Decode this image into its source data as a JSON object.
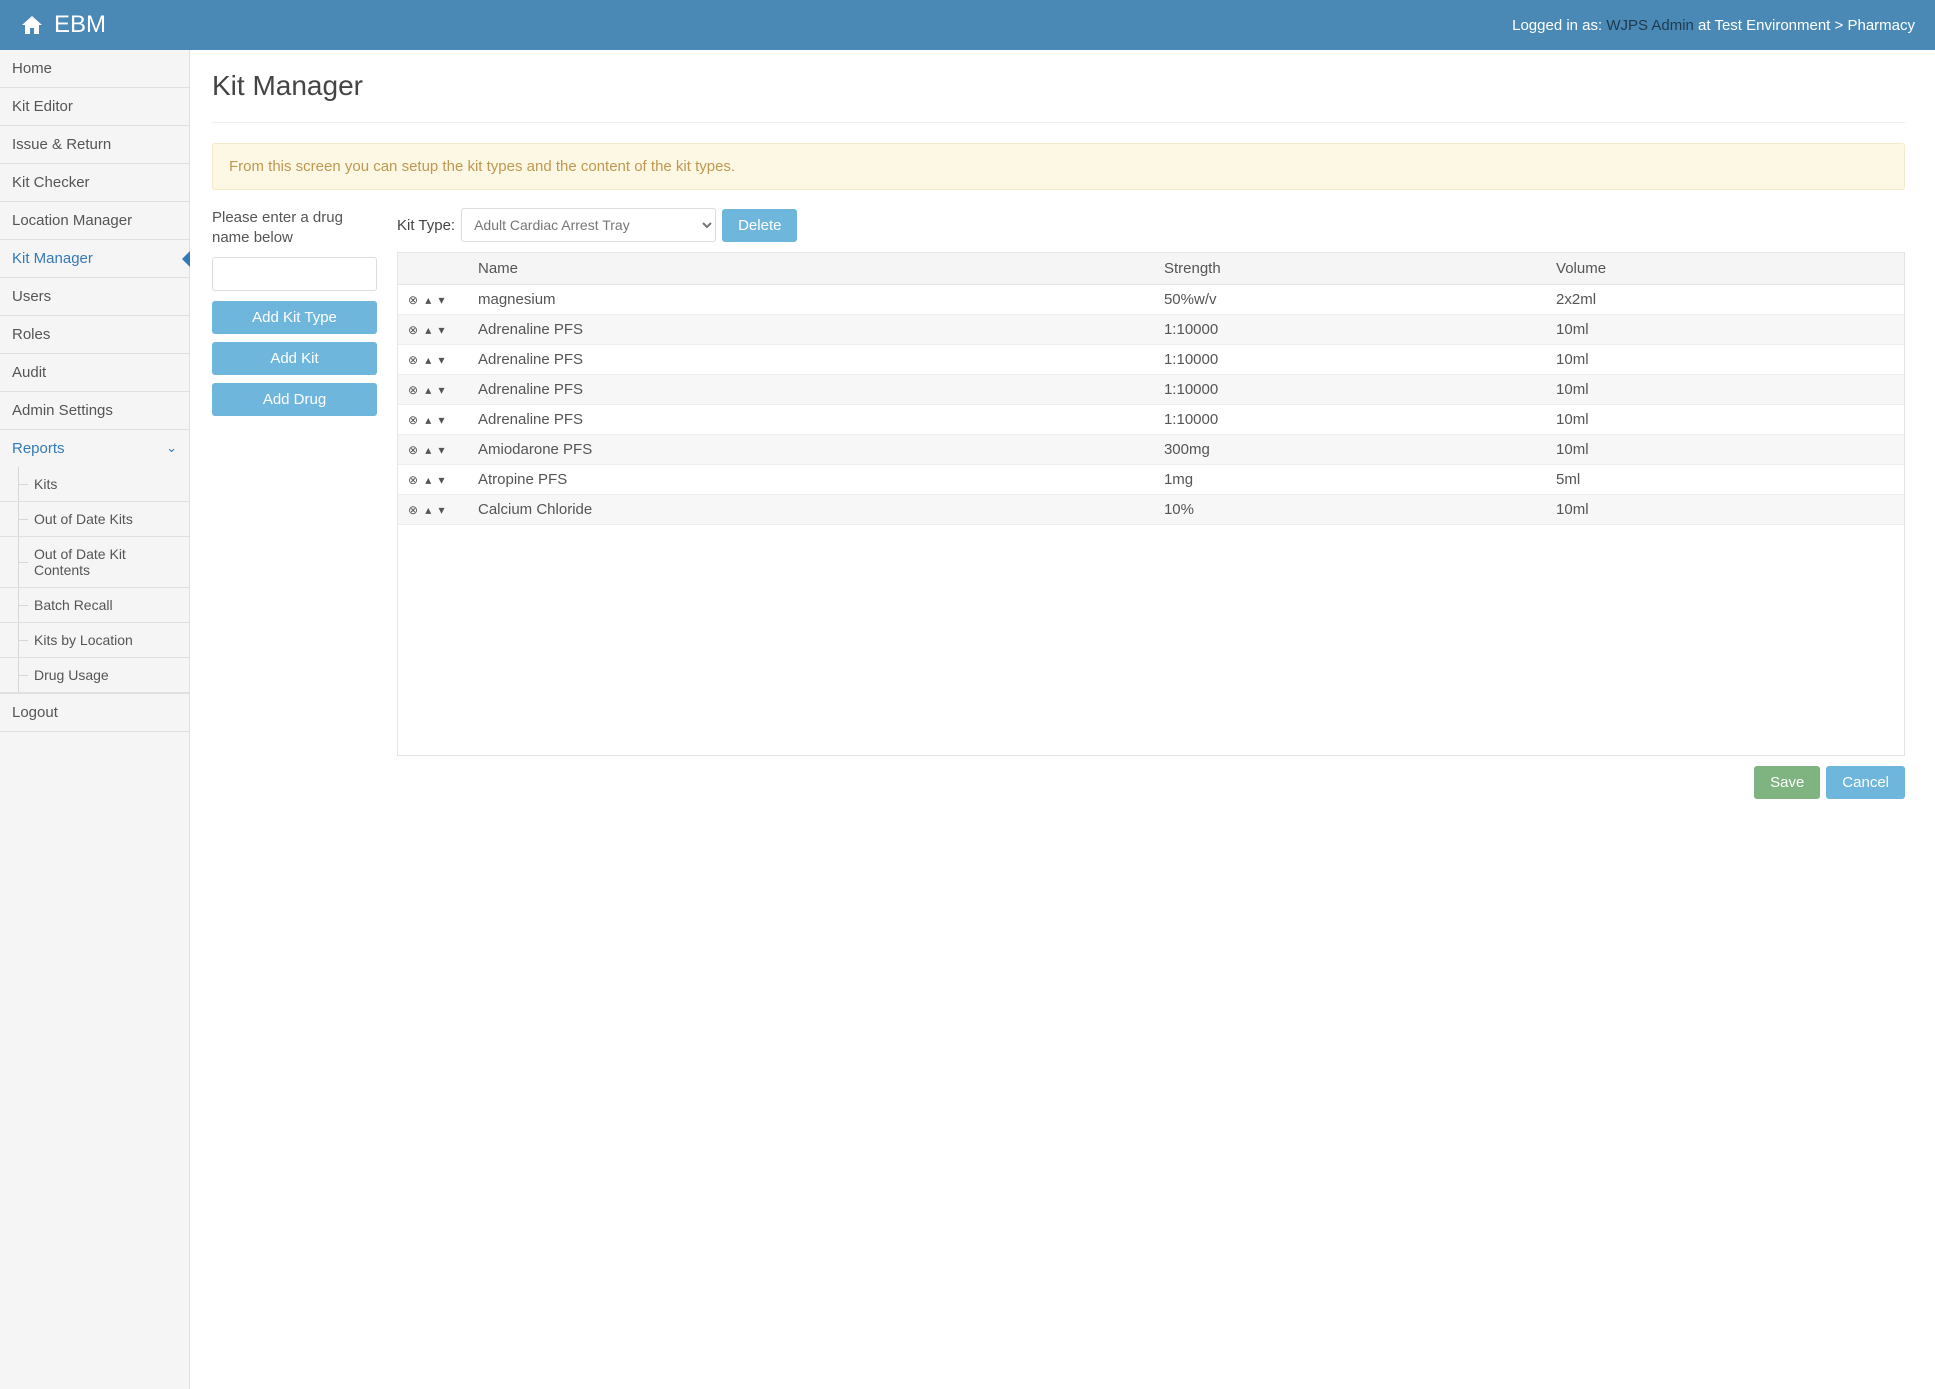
{
  "brand": "EBM",
  "topbar": {
    "logged_in_prefix": "Logged in as: ",
    "user": "WJPS Admin",
    "at": " at ",
    "env": "Test Environment",
    "sep": " > ",
    "location": "Pharmacy"
  },
  "sidebar": {
    "items": [
      {
        "label": "Home",
        "active": false
      },
      {
        "label": "Kit Editor",
        "active": false
      },
      {
        "label": "Issue & Return",
        "active": false
      },
      {
        "label": "Kit Checker",
        "active": false
      },
      {
        "label": "Location Manager",
        "active": false
      },
      {
        "label": "Kit Manager",
        "active": true
      },
      {
        "label": "Users",
        "active": false
      },
      {
        "label": "Roles",
        "active": false
      },
      {
        "label": "Audit",
        "active": false
      },
      {
        "label": "Admin Settings",
        "active": false
      }
    ],
    "reports_label": "Reports",
    "reports": [
      "Kits",
      "Out of Date Kits",
      "Out of Date Kit Contents",
      "Batch Recall",
      "Kits by Location",
      "Drug Usage"
    ],
    "logout": "Logout"
  },
  "page": {
    "title": "Kit Manager",
    "info": "From this screen you can setup the kit types and the content of the kit types.",
    "drug_hint": "Please enter a drug name below",
    "add_kit_type": "Add Kit Type",
    "add_kit": "Add Kit",
    "add_drug": "Add Drug",
    "kit_type_label": "Kit Type:",
    "kit_type_selected": "Adult Cardiac Arrest Tray",
    "delete": "Delete",
    "save": "Save",
    "cancel": "Cancel"
  },
  "table": {
    "headers": {
      "name": "Name",
      "strength": "Strength",
      "volume": "Volume"
    },
    "rows": [
      {
        "name": "magnesium",
        "strength": "50%w/v",
        "volume": "2x2ml"
      },
      {
        "name": "Adrenaline PFS",
        "strength": "1:10000",
        "volume": "10ml"
      },
      {
        "name": "Adrenaline PFS",
        "strength": "1:10000",
        "volume": "10ml"
      },
      {
        "name": "Adrenaline PFS",
        "strength": "1:10000",
        "volume": "10ml"
      },
      {
        "name": "Adrenaline PFS",
        "strength": "1:10000",
        "volume": "10ml"
      },
      {
        "name": "Amiodarone PFS",
        "strength": "300mg",
        "volume": "10ml"
      },
      {
        "name": "Atropine PFS",
        "strength": "1mg",
        "volume": "5ml"
      },
      {
        "name": "Calcium Chloride",
        "strength": "10%",
        "volume": "10ml"
      }
    ]
  }
}
